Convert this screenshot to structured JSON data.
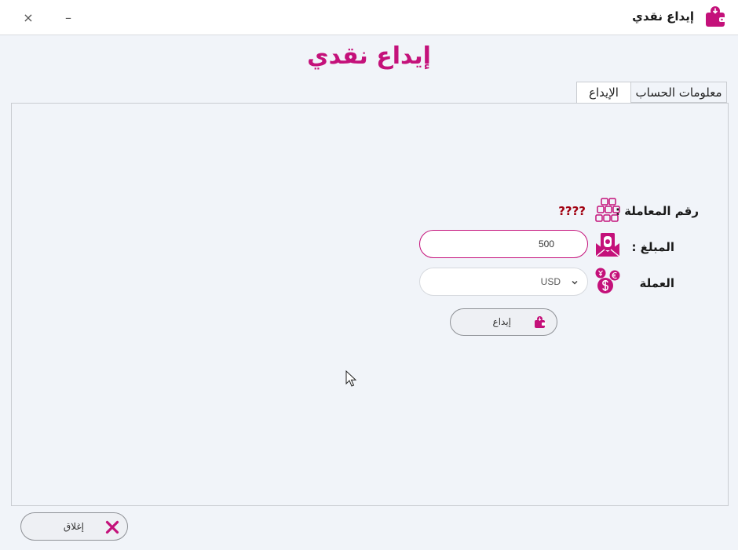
{
  "window": {
    "title": "إيداع نقدي",
    "close_symbol": "×",
    "minimize_symbol": "–",
    "app_icon": "wallet-download-icon"
  },
  "page": {
    "heading": "إيداع نقدي"
  },
  "tabs": [
    {
      "label": "الإيداع",
      "selected": true
    },
    {
      "label": "معلومات الحساب",
      "selected": false
    }
  ],
  "form": {
    "transaction_label": "رقم المعاملة :",
    "transaction_value": "????",
    "amount_label": "المبلغ :",
    "amount_value": "500",
    "currency_label": "العملة",
    "currency_value": "USD",
    "deposit_button": "إيداع"
  },
  "footer": {
    "close_button": "إغلاق"
  },
  "colors": {
    "accent": "#c4117a",
    "error_text": "#a10010",
    "background": "#f1f4f9"
  }
}
